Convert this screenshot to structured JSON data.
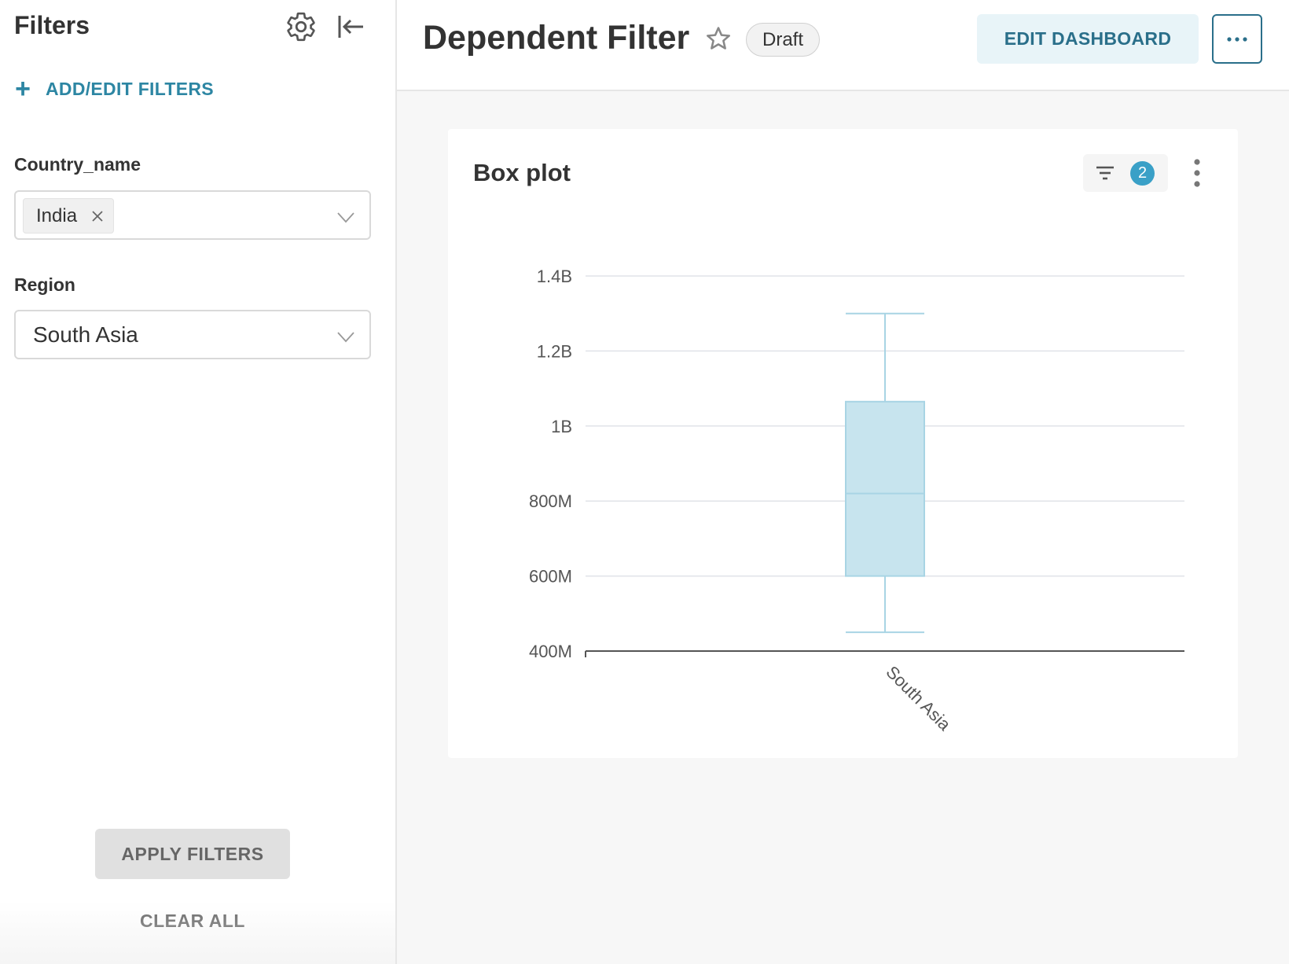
{
  "sidebar": {
    "title": "Filters",
    "add_edit_label": "ADD/EDIT FILTERS",
    "filters": [
      {
        "label": "Country_name",
        "selected_tags": [
          "India"
        ]
      },
      {
        "label": "Region",
        "value": "South Asia"
      }
    ],
    "apply_label": "APPLY FILTERS",
    "clear_label": "CLEAR ALL"
  },
  "header": {
    "title": "Dependent Filter",
    "status_badge": "Draft",
    "edit_label": "EDIT DASHBOARD",
    "more_label": "···"
  },
  "chart_card": {
    "title": "Box plot",
    "applied_filter_count": "2"
  },
  "colors": {
    "accent": "#2d86a3",
    "box_fill": "#c7e4ee",
    "box_stroke": "#a8d4e4",
    "badge": "#3aa0c7"
  },
  "icons": [
    "gear-icon",
    "collapse-left-icon",
    "plus-icon",
    "chevron-down-icon",
    "close-icon",
    "star-icon",
    "filter-icon",
    "vertical-dots-icon"
  ],
  "chart_data": {
    "type": "box",
    "categories": [
      "South Asia"
    ],
    "boxes": [
      {
        "category": "South Asia",
        "min": 450000000,
        "q1": 600000000,
        "median": 820000000,
        "q3": 1065000000,
        "max": 1300000000
      }
    ],
    "y_ticks": [
      {
        "value": 400000000,
        "label": "400M"
      },
      {
        "value": 600000000,
        "label": "600M"
      },
      {
        "value": 800000000,
        "label": "800M"
      },
      {
        "value": 1000000000,
        "label": "1B"
      },
      {
        "value": 1200000000,
        "label": "1.2B"
      },
      {
        "value": 1400000000,
        "label": "1.4B"
      }
    ],
    "ylim": [
      400000000,
      1400000000
    ],
    "grid": true,
    "xlabel": "",
    "ylabel": ""
  }
}
